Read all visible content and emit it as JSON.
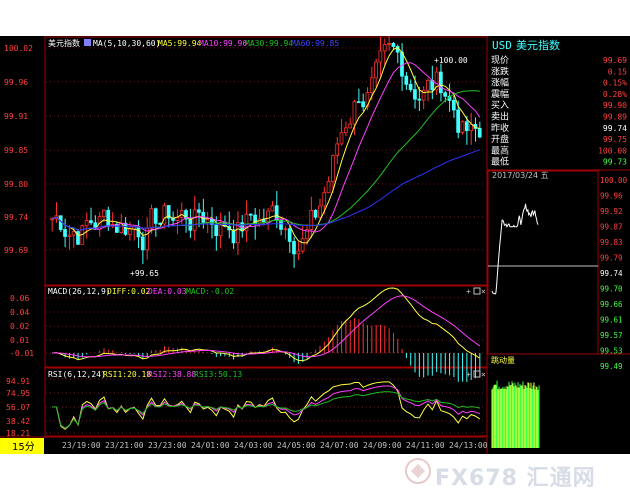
{
  "main_chart": {
    "title": "美元指数",
    "ma_params": "MA(5,10,30,60)",
    "ma5": "MA5:99.94",
    "ma10": "MA10:99.96",
    "ma30": "MA30:99.94",
    "ma60": "MA60:99.85",
    "y_ticks": [
      "100.02",
      "99.96",
      "99.91",
      "99.85",
      "99.80",
      "99.74",
      "99.69"
    ],
    "high_annotation": "+100.00",
    "low_annotation": "+99.65",
    "colors": {
      "up": "#ff3030",
      "down": "#40ffff",
      "ma5": "#ffff40",
      "ma10": "#ff40ff",
      "ma30": "#20c020",
      "ma60": "#2020ff"
    }
  },
  "macd_panel": {
    "label": "MACD(26,12,9)",
    "diff": "DIFF:0.02",
    "dea": "DEA:0.03",
    "macd": "MACD:-0.02",
    "y_ticks": [
      "0.06",
      "0.04",
      "0.02",
      "0.01",
      "-0.01"
    ]
  },
  "rsi_panel": {
    "label": "RSI(6,12,24)",
    "rsi1": "RSI1:20.18",
    "rsi2": "RSI2:38.88",
    "rsi3": "RSI3:50.13",
    "y_ticks": [
      "94.91",
      "74.95",
      "56.07",
      "38.42",
      "18.21"
    ]
  },
  "time_axis": {
    "period_button": "15分",
    "labels": [
      "23/19:00",
      "23/21:00",
      "23/23:00",
      "24/01:00",
      "24/03:00",
      "24/05:00",
      "24/07:00",
      "24/09:00",
      "24/11:00",
      "24/13:00"
    ]
  },
  "quote_panel": {
    "symbol": "USD",
    "name": "美元指数",
    "rows": [
      {
        "label": "现价",
        "value": "99.69",
        "color": "#ff4040"
      },
      {
        "label": "涨跌",
        "value": "0.15",
        "color": "#ff4040"
      },
      {
        "label": "涨幅",
        "value": "0.15%",
        "color": "#ff4040"
      },
      {
        "label": "震幅",
        "value": "0.28%",
        "color": "#ff4040"
      },
      {
        "label": "买入",
        "value": "99.90",
        "color": "#ff4040"
      },
      {
        "label": "卖出",
        "value": "99.89",
        "color": "#ff4040"
      },
      {
        "label": "昨收",
        "value": "99.74",
        "color": "#ffffff"
      },
      {
        "label": "开盘",
        "value": "99.75",
        "color": "#ff4040"
      },
      {
        "label": "最高",
        "value": "100.00",
        "color": "#ff4040"
      },
      {
        "label": "最低",
        "value": "99.73",
        "color": "#40ff40"
      }
    ]
  },
  "intraday_panel": {
    "header": "2017/03/24 五",
    "y_ticks": [
      {
        "v": "100.00",
        "c": "#ff4040"
      },
      {
        "v": "99.96",
        "c": "#ff4040"
      },
      {
        "v": "99.92",
        "c": "#ff4040"
      },
      {
        "v": "99.87",
        "c": "#ff4040"
      },
      {
        "v": "99.83",
        "c": "#ff4040"
      },
      {
        "v": "99.79",
        "c": "#ff4040"
      },
      {
        "v": "99.74",
        "c": "#ffffff"
      },
      {
        "v": "99.70",
        "c": "#40ff40"
      },
      {
        "v": "99.66",
        "c": "#40ff40"
      },
      {
        "v": "99.61",
        "c": "#40ff40"
      },
      {
        "v": "99.57",
        "c": "#40ff40"
      },
      {
        "v": "99.53",
        "c": "#40ff40"
      },
      {
        "v": "99.49",
        "c": "#40ff40"
      }
    ],
    "volume_label": "跳动量"
  },
  "watermark": "FX678 汇通网"
}
